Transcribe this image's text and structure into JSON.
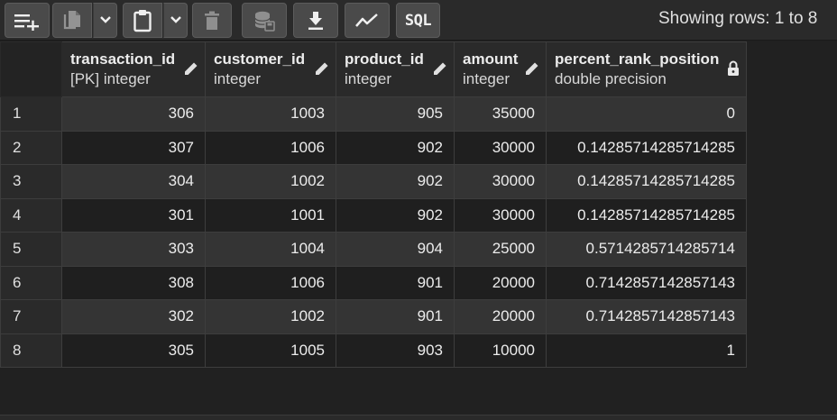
{
  "toolbar": {
    "buttons": [
      {
        "name": "add-row",
        "icon": "add-row-icon"
      },
      {
        "name": "copy",
        "icon": "copy-icon"
      },
      {
        "name": "copy-options",
        "icon": "chevron-down-icon"
      },
      {
        "name": "paste",
        "icon": "paste-icon"
      },
      {
        "name": "paste-options",
        "icon": "chevron-down-icon"
      },
      {
        "name": "delete",
        "icon": "trash-icon"
      },
      {
        "name": "save-data",
        "icon": "database-save-icon"
      },
      {
        "name": "download",
        "icon": "download-icon"
      },
      {
        "name": "graph-visualiser",
        "icon": "line-chart-icon"
      }
    ],
    "sql_label": "SQL",
    "rows_status": "Showing rows: 1 to 8"
  },
  "grid": {
    "columns": [
      {
        "name": "transaction_id",
        "type": "[PK] integer",
        "icon": "pencil-icon"
      },
      {
        "name": "customer_id",
        "type": "integer",
        "icon": "pencil-icon"
      },
      {
        "name": "product_id",
        "type": "integer",
        "icon": "pencil-icon"
      },
      {
        "name": "amount",
        "type": "integer",
        "icon": "pencil-icon"
      },
      {
        "name": "percent_rank_position",
        "type": "double precision",
        "icon": "lock-icon"
      }
    ],
    "rows": [
      {
        "num": "1",
        "cells": [
          "306",
          "1003",
          "905",
          "35000",
          "0"
        ]
      },
      {
        "num": "2",
        "cells": [
          "307",
          "1006",
          "902",
          "30000",
          "0.14285714285714285"
        ]
      },
      {
        "num": "3",
        "cells": [
          "304",
          "1002",
          "902",
          "30000",
          "0.14285714285714285"
        ]
      },
      {
        "num": "4",
        "cells": [
          "301",
          "1001",
          "902",
          "30000",
          "0.14285714285714285"
        ]
      },
      {
        "num": "5",
        "cells": [
          "303",
          "1004",
          "904",
          "25000",
          "0.5714285714285714"
        ]
      },
      {
        "num": "6",
        "cells": [
          "308",
          "1006",
          "901",
          "20000",
          "0.7142857142857143"
        ]
      },
      {
        "num": "7",
        "cells": [
          "302",
          "1002",
          "901",
          "20000",
          "0.7142857142857143"
        ]
      },
      {
        "num": "8",
        "cells": [
          "305",
          "1005",
          "903",
          "10000",
          "1"
        ]
      }
    ]
  },
  "colors": {
    "background": "#212121",
    "toolbar_button": "#4a4a4a",
    "row_odd": "#343434",
    "row_even": "#1f1f1f",
    "text": "#e6e6e6"
  }
}
